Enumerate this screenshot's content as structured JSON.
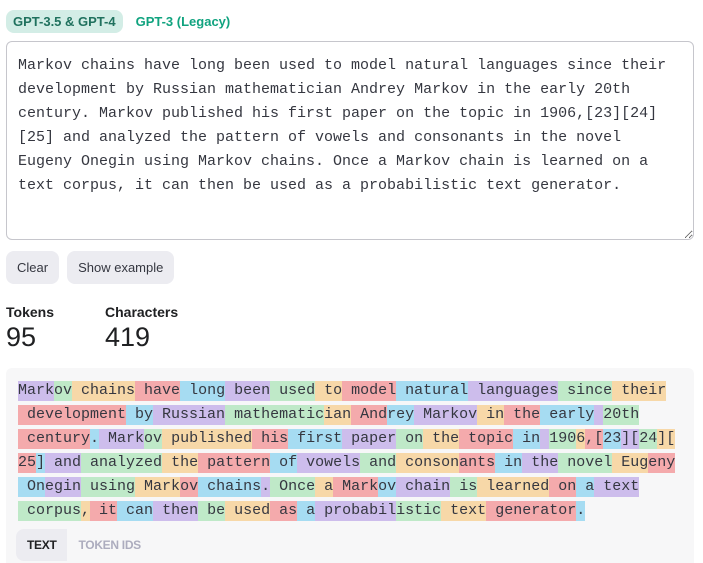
{
  "model_tabs": [
    {
      "label": "GPT-3.5 & GPT-4",
      "active": true
    },
    {
      "label": "GPT-3 (Legacy)",
      "active": false
    }
  ],
  "input_text": "Markov chains have long been used to model natural languages since their development by Russian mathematician Andrey Markov in the early 20th century. Markov published his first paper on the topic in 1906,[23][24][25] and analyzed the pattern of vowels and consonants in the novel Eugeny Onegin using Markov chains. Once a Markov chain is learned on a text corpus, it can then be used as a probabilistic text generator.",
  "buttons": {
    "clear": "Clear",
    "show_example": "Show example"
  },
  "stats": {
    "tokens_label": "Tokens",
    "tokens_value": "95",
    "characters_label": "Characters",
    "characters_value": "419"
  },
  "token_colors": [
    "#cdbdec",
    "#bfe9c8",
    "#f7d8a8",
    "#f4aaac",
    "#a6dcf2"
  ],
  "token_lines": [
    [
      [
        "Mark",
        0
      ],
      [
        "ov",
        1
      ],
      [
        " chains",
        2
      ],
      [
        " have",
        3
      ],
      [
        " long",
        4
      ],
      [
        " been",
        0
      ],
      [
        " used",
        1
      ],
      [
        " to",
        2
      ],
      [
        " model",
        3
      ],
      [
        " natural",
        4
      ],
      [
        " languages",
        0
      ],
      [
        " since",
        1
      ],
      [
        " their",
        2
      ]
    ],
    [
      [
        " development",
        3
      ],
      [
        " by",
        4
      ],
      [
        " Russian",
        0
      ],
      [
        " mathematic",
        1
      ],
      [
        "ian",
        2
      ],
      [
        " And",
        3
      ],
      [
        "rey",
        4
      ],
      [
        " Markov",
        0
      ],
      [
        " in",
        2
      ],
      [
        " the",
        3
      ],
      [
        " early",
        4
      ],
      [
        " ",
        0
      ],
      [
        "20th",
        1
      ]
    ],
    [
      [
        " century",
        3
      ],
      [
        ".",
        4
      ],
      [
        " Mark",
        0
      ],
      [
        "ov",
        1
      ],
      [
        " published",
        2
      ],
      [
        " his",
        3
      ],
      [
        " first",
        4
      ],
      [
        " paper",
        0
      ],
      [
        " on",
        1
      ],
      [
        " the",
        2
      ],
      [
        " topic",
        3
      ],
      [
        " in",
        4
      ],
      [
        " ",
        0
      ],
      [
        "190",
        1
      ],
      [
        "6",
        2
      ],
      [
        ",[",
        3
      ],
      [
        "23",
        4
      ],
      [
        "][",
        0
      ],
      [
        "24",
        1
      ],
      [
        "][",
        2
      ]
    ],
    [
      [
        "25",
        3
      ],
      [
        "]",
        4
      ],
      [
        " and",
        0
      ],
      [
        " analyzed",
        1
      ],
      [
        " the",
        2
      ],
      [
        " pattern",
        3
      ],
      [
        " of",
        4
      ],
      [
        " vowels",
        0
      ],
      [
        " and",
        1
      ],
      [
        " conson",
        2
      ],
      [
        "ants",
        3
      ],
      [
        " in",
        4
      ],
      [
        " the",
        0
      ],
      [
        " novel",
        1
      ],
      [
        " Eug",
        2
      ],
      [
        "eny",
        3
      ]
    ],
    [
      [
        " On",
        4
      ],
      [
        "egin",
        0
      ],
      [
        " using",
        1
      ],
      [
        " Mark",
        2
      ],
      [
        "ov",
        3
      ],
      [
        " chains",
        4
      ],
      [
        ".",
        0
      ],
      [
        " Once",
        1
      ],
      [
        " a",
        2
      ],
      [
        " Mark",
        3
      ],
      [
        "ov",
        4
      ],
      [
        " chain",
        0
      ],
      [
        " is",
        1
      ],
      [
        " learned",
        2
      ],
      [
        " on",
        3
      ],
      [
        " a",
        4
      ],
      [
        " text",
        0
      ]
    ],
    [
      [
        " corpus",
        1
      ],
      [
        ",",
        2
      ],
      [
        " it",
        3
      ],
      [
        " can",
        4
      ],
      [
        " then",
        0
      ],
      [
        " be",
        1
      ],
      [
        " used",
        2
      ],
      [
        " as",
        3
      ],
      [
        " a",
        4
      ],
      [
        " probabil",
        0
      ],
      [
        "istic",
        1
      ],
      [
        " text",
        2
      ],
      [
        " generator",
        3
      ],
      [
        ".",
        4
      ]
    ]
  ],
  "view_tabs": [
    {
      "label": "TEXT",
      "active": true
    },
    {
      "label": "TOKEN IDS",
      "active": false
    }
  ]
}
